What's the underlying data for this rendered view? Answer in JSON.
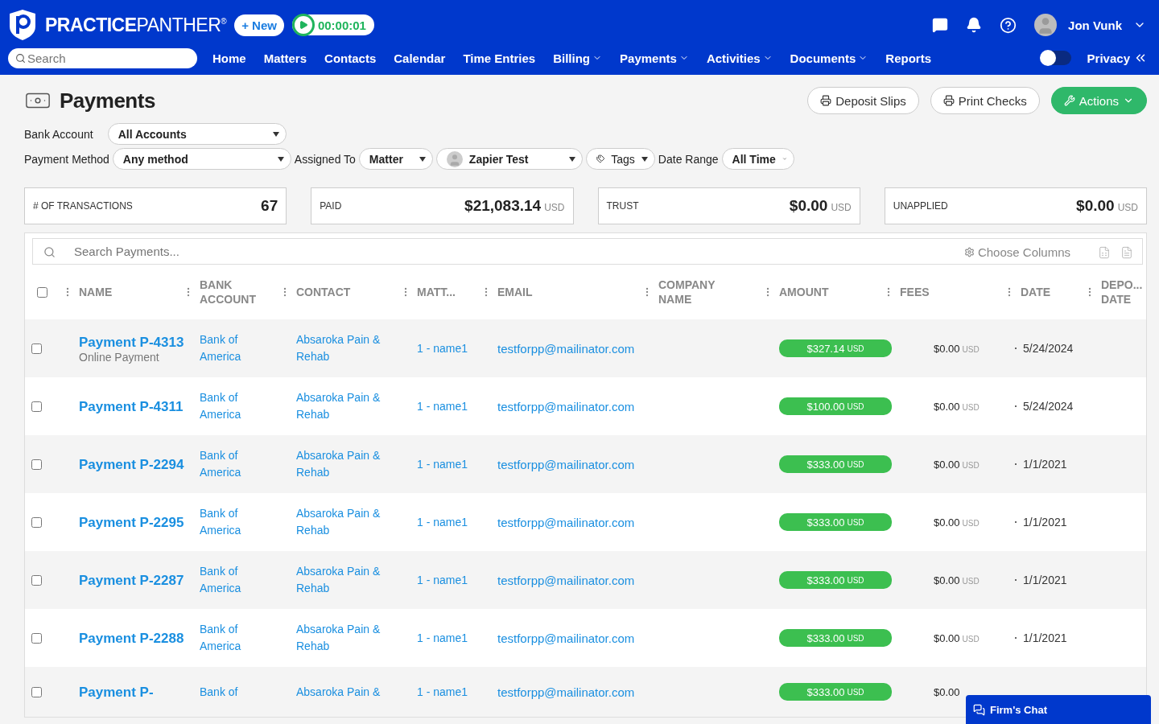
{
  "brand": {
    "strong": "PRACTICE",
    "light": "PANTHER",
    "mark": "®"
  },
  "new_button": "+ New",
  "timer": {
    "time": "00:00:01",
    "running": false
  },
  "user": {
    "name": "Jon Vunk"
  },
  "search": {
    "placeholder": "Search"
  },
  "nav": [
    {
      "label": "Home",
      "has_menu": false
    },
    {
      "label": "Matters",
      "has_menu": false
    },
    {
      "label": "Contacts",
      "has_menu": false
    },
    {
      "label": "Calendar",
      "has_menu": false
    },
    {
      "label": "Time Entries",
      "has_menu": false
    },
    {
      "label": "Billing",
      "has_menu": true
    },
    {
      "label": "Payments",
      "has_menu": true
    },
    {
      "label": "Activities",
      "has_menu": true
    },
    {
      "label": "Documents",
      "has_menu": true
    },
    {
      "label": "Reports",
      "has_menu": false
    }
  ],
  "privacy": {
    "label": "Privacy",
    "on": false
  },
  "page_title": "Payments",
  "actions": [
    {
      "label": "Deposit Slips",
      "kind": "print"
    },
    {
      "label": "Print Checks",
      "kind": "print"
    },
    {
      "label": "Actions",
      "kind": "primary"
    }
  ],
  "filters": {
    "bank_account": {
      "label": "Bank Account",
      "value": "All Accounts"
    },
    "payment_method": {
      "label": "Payment Method",
      "value": "Any method"
    },
    "assigned_to": {
      "label": "Assigned To",
      "value": "Matter"
    },
    "contact": {
      "value": "Zapier Test"
    },
    "tags": {
      "value": "Tags"
    },
    "date_range": {
      "label": "Date Range",
      "value": "All Time"
    }
  },
  "stats": [
    {
      "label": "# OF TRANSACTIONS",
      "value": "67"
    },
    {
      "label": "PAID",
      "value": "$21,083.14",
      "currency": "USD"
    },
    {
      "label": "TRUST",
      "value": "$0.00",
      "currency": "USD"
    },
    {
      "label": "UNAPPLIED",
      "value": "$0.00",
      "currency": "USD"
    }
  ],
  "table": {
    "select_all_checked": false,
    "search_placeholder": "Search Payments...",
    "choose_columns": "Choose Columns",
    "columns": [
      "NAME",
      "BANK ACCOUNT",
      "CONTACT",
      "MATT...",
      "EMAIL",
      "COMPANY NAME",
      "AMOUNT",
      "FEES",
      "DATE",
      "DEPO... DATE"
    ],
    "rows": [
      {
        "checked": false,
        "name": "Payment P-4313",
        "subtitle": "Online Payment",
        "bank": "Bank of America",
        "contact": "Absaroka Pain & Rehab",
        "matter": "1 - name1",
        "email": "testforpp@mailinator.com",
        "amount": "$327.14",
        "amount_currency": "USD",
        "fees": "$0.00",
        "fees_currency": "USD",
        "date": "5/24/2024"
      },
      {
        "checked": false,
        "name": "Payment P-4311",
        "bank": "Bank of America",
        "contact": "Absaroka Pain & Rehab",
        "matter": "1 - name1",
        "email": "testforpp@mailinator.com",
        "amount": "$100.00",
        "amount_currency": "USD",
        "fees": "$0.00",
        "fees_currency": "USD",
        "date": "5/24/2024"
      },
      {
        "checked": false,
        "name": "Payment P-2294",
        "bank": "Bank of America",
        "contact": "Absaroka Pain & Rehab",
        "matter": "1 - name1",
        "email": "testforpp@mailinator.com",
        "amount": "$333.00",
        "amount_currency": "USD",
        "fees": "$0.00",
        "fees_currency": "USD",
        "date": "1/1/2021"
      },
      {
        "checked": false,
        "name": "Payment P-2295",
        "bank": "Bank of America",
        "contact": "Absaroka Pain & Rehab",
        "matter": "1 - name1",
        "email": "testforpp@mailinator.com",
        "amount": "$333.00",
        "amount_currency": "USD",
        "fees": "$0.00",
        "fees_currency": "USD",
        "date": "1/1/2021"
      },
      {
        "checked": false,
        "name": "Payment P-2287",
        "bank": "Bank of America",
        "contact": "Absaroka Pain & Rehab",
        "matter": "1 - name1",
        "email": "testforpp@mailinator.com",
        "amount": "$333.00",
        "amount_currency": "USD",
        "fees": "$0.00",
        "fees_currency": "USD",
        "date": "1/1/2021"
      },
      {
        "checked": false,
        "name": "Payment P-2288",
        "bank": "Bank of America",
        "contact": "Absaroka Pain & Rehab",
        "matter": "1 - name1",
        "email": "testforpp@mailinator.com",
        "amount": "$333.00",
        "amount_currency": "USD",
        "fees": "$0.00",
        "fees_currency": "USD",
        "date": "1/1/2021"
      },
      {
        "checked": false,
        "name": "Payment P-",
        "bank": "Bank of",
        "contact": "Absaroka Pain &",
        "matter": "1 - name1",
        "email": "testforpp@mailinator.com",
        "amount": "$333.00",
        "amount_currency": "USD",
        "fees": "$0.00"
      }
    ]
  },
  "chat": {
    "label": "Firm's Chat"
  }
}
